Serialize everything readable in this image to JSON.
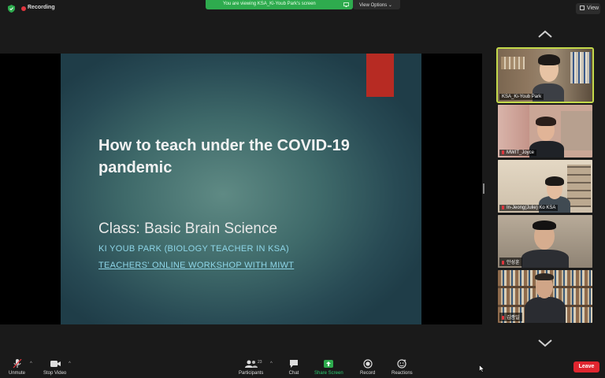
{
  "top_bar": {
    "recording_label": "Recording",
    "share_banner": "You are viewing KSA_Ki-Youb Park's screen",
    "view_options_label": "View Options",
    "view_button_label": "View"
  },
  "slide": {
    "title": "How to teach under the COVID-19 pandemic",
    "class_line": "Class: Basic Brain Science",
    "author_line": "KI YOUB PARK (BIOLOGY TEACHER IN KSA)",
    "workshop_line": "TEACHERS' ONLINE WORKSHOP WITH MIWT"
  },
  "gallery": {
    "participants": [
      {
        "name": "KSA_Ki-Youb Park",
        "active": true
      },
      {
        "name": "MWIT_Joyce",
        "active": false
      },
      {
        "name": "In-Jeong(Julie) Ko KSA",
        "active": false
      },
      {
        "name": "안성훈",
        "active": false
      },
      {
        "name": "김종일",
        "active": false
      }
    ]
  },
  "toolbar": {
    "unmute_label": "Unmute",
    "stop_video_label": "Stop Video",
    "participants_label": "Participants",
    "participants_count": "23",
    "chat_label": "Chat",
    "share_screen_label": "Share Screen",
    "record_label": "Record",
    "reactions_label": "Reactions",
    "leave_label": "Leave"
  },
  "colors": {
    "accent_green": "#2eab4e",
    "active_speaker": "#c3d94a",
    "leave_red": "#e0262f",
    "recording_red": "#e0353e"
  },
  "icons": [
    "shield-icon",
    "recording-dot-icon",
    "share-screen-indicator-icon",
    "chevron-up-icon",
    "chevron-down-icon",
    "microphone-muted-icon",
    "video-camera-icon",
    "participants-icon",
    "chat-bubble-icon",
    "share-screen-icon",
    "record-icon",
    "reactions-icon",
    "cursor-icon"
  ]
}
